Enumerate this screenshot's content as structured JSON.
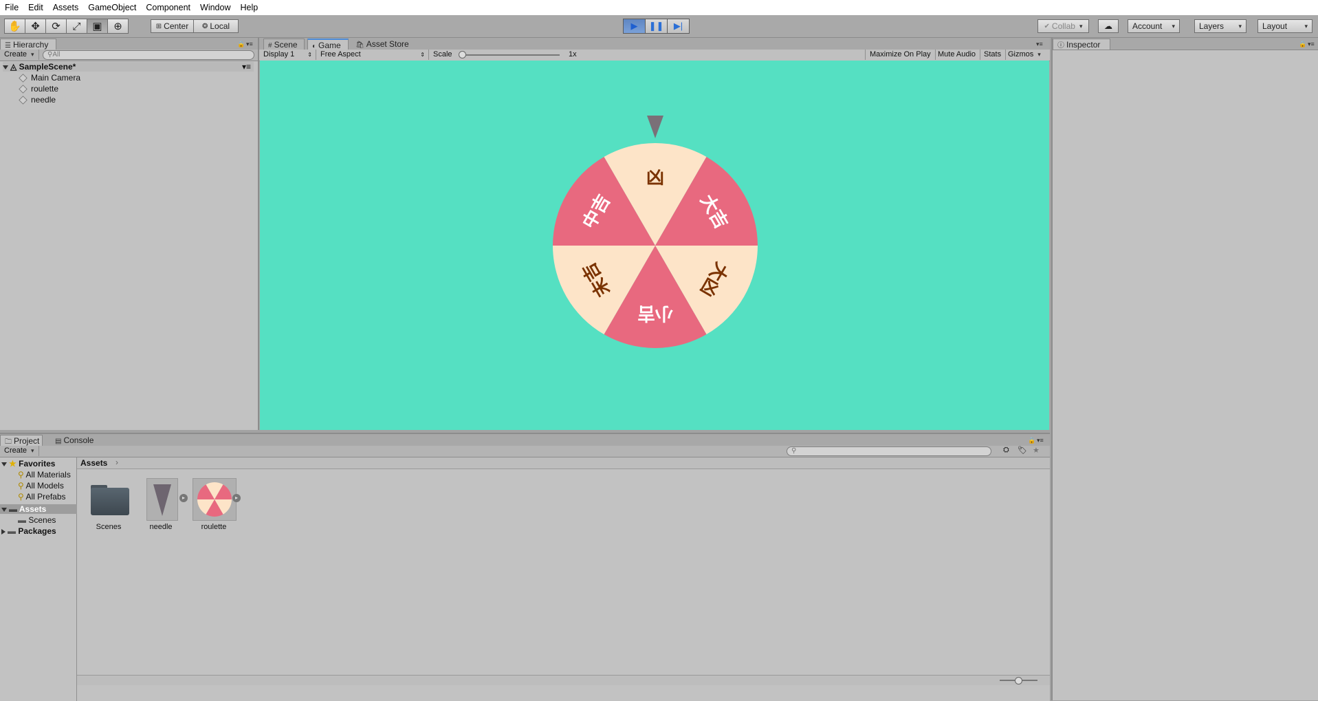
{
  "menu": [
    "File",
    "Edit",
    "Assets",
    "GameObject",
    "Component",
    "Window",
    "Help"
  ],
  "toolbar": {
    "tools": [
      {
        "name": "hand-tool-icon",
        "glyph": "✋"
      },
      {
        "name": "move-tool-icon",
        "glyph": "✥"
      },
      {
        "name": "rotate-tool-icon",
        "glyph": "⟳"
      },
      {
        "name": "scale-tool-icon",
        "glyph": "⤢"
      },
      {
        "name": "rect-tool-icon",
        "glyph": "▣"
      },
      {
        "name": "transform-tool-icon",
        "glyph": "⊕"
      }
    ],
    "pivot_mode": "Center",
    "pivot_rotation": "Local",
    "collab": "Collab",
    "account": "Account",
    "layers": "Layers",
    "layout": "Layout"
  },
  "hierarchy": {
    "tab": "Hierarchy",
    "create": "Create",
    "search_placeholder": "All",
    "scene": "SampleScene*",
    "objects": [
      "Main Camera",
      "roulette",
      "needle"
    ]
  },
  "game": {
    "tabs": [
      "Scene",
      "Game",
      "Asset Store"
    ],
    "display": "Display 1",
    "aspect": "Free Aspect",
    "scale_label": "Scale",
    "scale_value": "1x",
    "toggles": [
      "Maximize On Play",
      "Mute Audio",
      "Stats",
      "Gizmos"
    ],
    "background": "#55e0c2",
    "wheel": {
      "colors": {
        "pink": "#e8697f",
        "cream": "#fde4c8",
        "dark_text": "#7a3200",
        "light_text": "#ffffff",
        "needle": "#7a7078"
      },
      "segments": [
        "凶",
        "大吉",
        "大凶",
        "小吉",
        "末吉",
        "中吉"
      ]
    }
  },
  "inspector": {
    "tab": "Inspector"
  },
  "project": {
    "tabs": [
      "Project",
      "Console"
    ],
    "create": "Create",
    "favorites_label": "Favorites",
    "favorites": [
      "All Materials",
      "All Models",
      "All Prefabs"
    ],
    "assets_label": "Assets",
    "asset_children": [
      "Scenes"
    ],
    "packages_label": "Packages",
    "breadcrumb": "Assets",
    "assets": [
      {
        "label": "Scenes",
        "icon": "folder-icon"
      },
      {
        "label": "needle",
        "icon": "needle-sprite-icon"
      },
      {
        "label": "roulette",
        "icon": "roulette-sprite-icon"
      }
    ]
  }
}
